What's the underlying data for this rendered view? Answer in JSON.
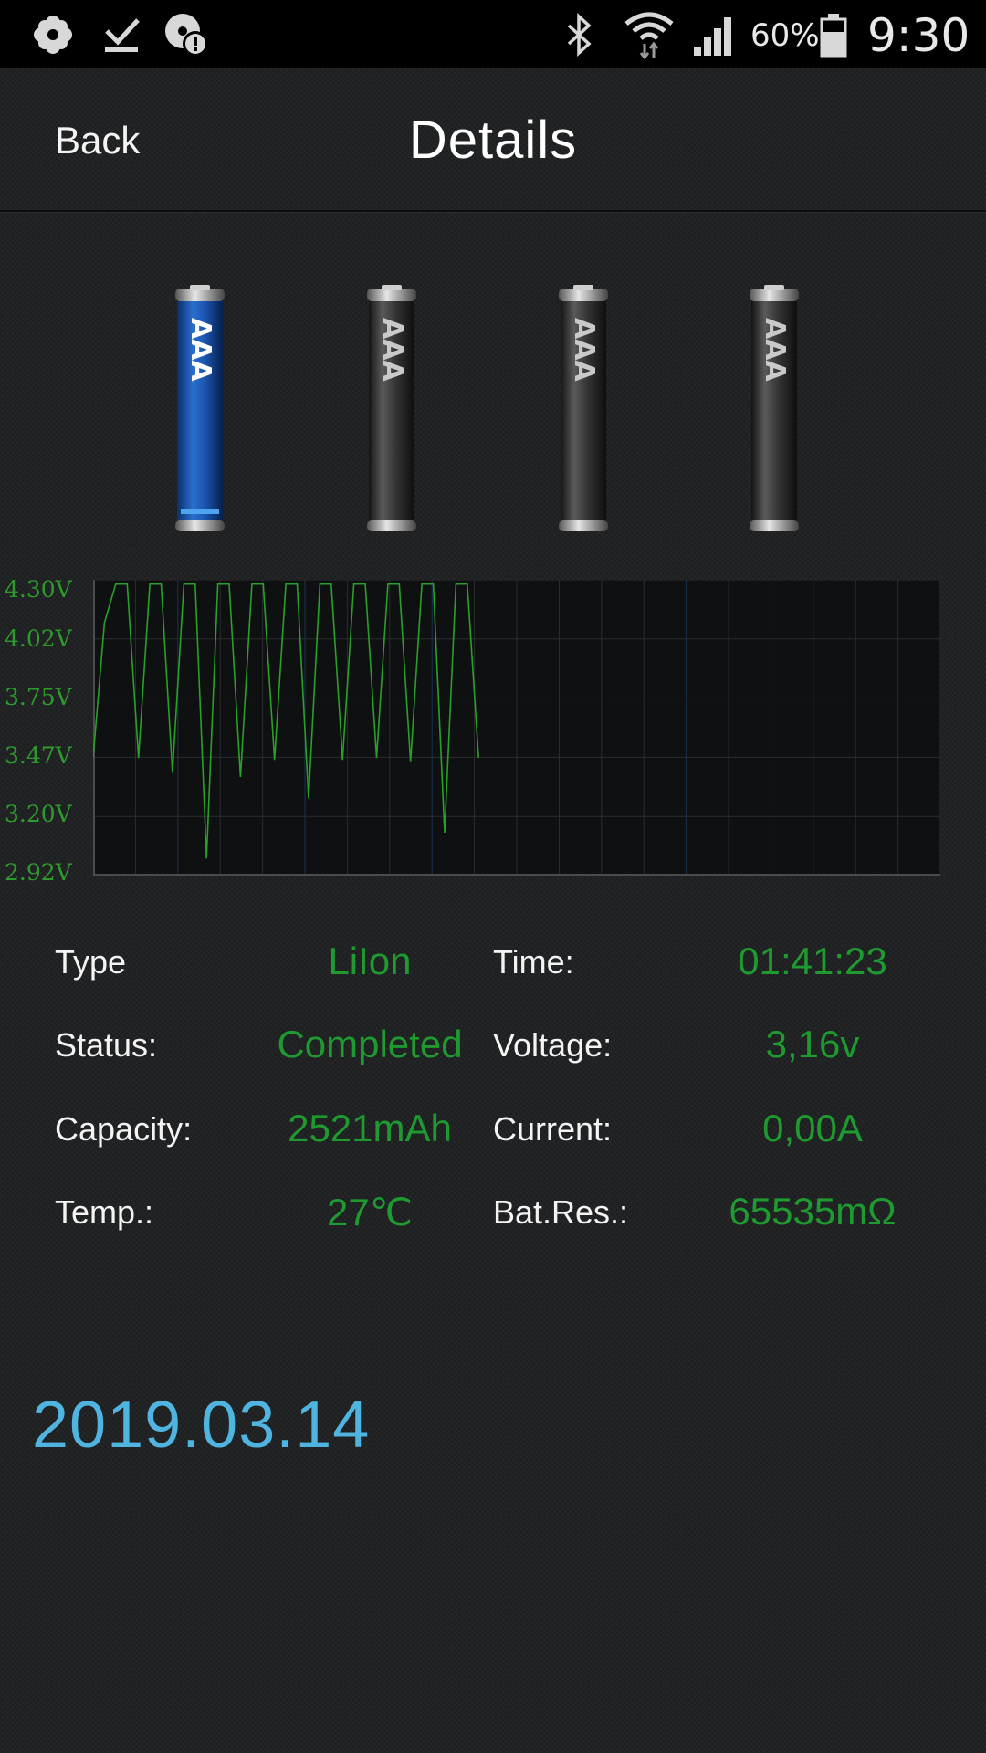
{
  "status_bar": {
    "battery_percent": "60%",
    "clock": "9:30",
    "icons": [
      "flower-icon",
      "download-done-icon",
      "disc-alert-icon",
      "bluetooth-icon",
      "wifi-icon",
      "cell-signal-icon",
      "battery-icon"
    ]
  },
  "header": {
    "back_label": "Back",
    "title": "Details"
  },
  "slots": [
    {
      "label": "AAA",
      "state": "active",
      "color": "#1e5bb0"
    },
    {
      "label": "AAA",
      "state": "inactive",
      "color": "#3a3a3a"
    },
    {
      "label": "AAA",
      "state": "inactive",
      "color": "#3a3a3a"
    },
    {
      "label": "AAA",
      "state": "inactive",
      "color": "#3a3a3a"
    }
  ],
  "chart_data": {
    "type": "line",
    "yticks": [
      "4.30V",
      "4.02V",
      "3.75V",
      "3.47V",
      "3.20V",
      "2.92V"
    ],
    "ylim": [
      2.92,
      4.3
    ],
    "grid": true,
    "line_color": "#2aa02a",
    "series": [
      {
        "values": [
          3.47,
          4.1,
          4.28,
          4.28,
          3.47,
          4.28,
          4.28,
          3.4,
          4.28,
          4.28,
          3.0,
          4.28,
          4.28,
          3.38,
          4.28,
          4.28,
          3.46,
          4.28,
          4.28,
          3.28,
          4.28,
          4.28,
          3.46,
          4.28,
          4.28,
          3.47,
          4.28,
          4.28,
          3.45,
          4.28,
          4.28,
          3.12,
          4.28,
          4.28,
          3.47
        ]
      }
    ]
  },
  "info": {
    "type_label": "Type",
    "type_value": "LiIon",
    "status_label": "Status:",
    "status_value": "Completed",
    "capacity_label": "Capacity:",
    "capacity_value": "2521mAh",
    "temp_label": "Temp.:",
    "temp_value": "27℃",
    "time_label": "Time:",
    "time_value": "01:41:23",
    "voltage_label": "Voltage:",
    "voltage_value": "3,16v",
    "current_label": "Current:",
    "current_value": "0,00A",
    "res_label": "Bat.Res.:",
    "res_value": "65535mΩ"
  },
  "date": "2019.03.14"
}
